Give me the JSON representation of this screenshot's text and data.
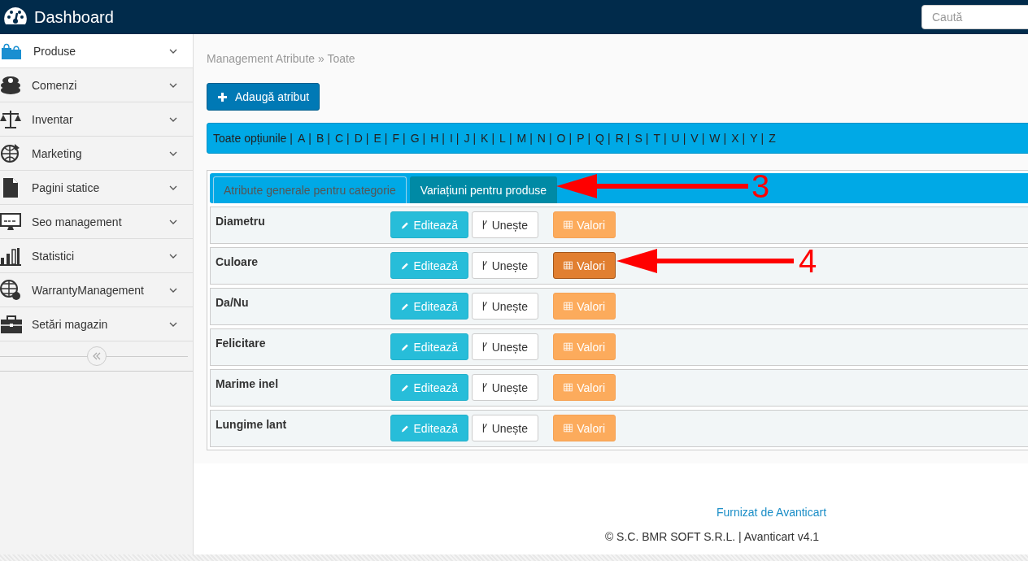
{
  "header": {
    "title": "Dashboard",
    "search": {
      "placeholder": "Caută"
    }
  },
  "sidebar": {
    "items": [
      {
        "label": "Produse",
        "selected": true
      },
      {
        "label": "Comenzi",
        "selected": false
      },
      {
        "label": "Inventar",
        "selected": false
      },
      {
        "label": "Marketing",
        "selected": false
      },
      {
        "label": "Pagini statice",
        "selected": false
      },
      {
        "label": "Seo management",
        "selected": false
      },
      {
        "label": "Statistici",
        "selected": false
      },
      {
        "label": "WarrantyManagement",
        "selected": false
      },
      {
        "label": "Setări magazin",
        "selected": false
      }
    ]
  },
  "breadcrumb": "Management Atribute » Toate",
  "add_button": "Adaugă atribut",
  "letter_separator": "|",
  "letter_filter": [
    "Toate opțiunile",
    "A",
    "B",
    "C",
    "D",
    "E",
    "F",
    "G",
    "H",
    "I",
    "J",
    "K",
    "L",
    "M",
    "N",
    "O",
    "P",
    "Q",
    "R",
    "S",
    "T",
    "U",
    "V",
    "W",
    "X",
    "Y",
    "Z"
  ],
  "tabs": [
    {
      "label": "Atribute generale pentru categorie",
      "selected": false
    },
    {
      "label": "Variațiuni pentru produse",
      "selected": true
    }
  ],
  "rows": [
    {
      "name": "Diametru",
      "edit": "Editează",
      "merge": "Unește",
      "values": "Valori",
      "values_active": false
    },
    {
      "name": "Culoare",
      "edit": "Editează",
      "merge": "Unește",
      "values": "Valori",
      "values_active": true
    },
    {
      "name": "Da/Nu",
      "edit": "Editează",
      "merge": "Unește",
      "values": "Valori",
      "values_active": false
    },
    {
      "name": "Felicitare",
      "edit": "Editează",
      "merge": "Unește",
      "values": "Valori",
      "values_active": false
    },
    {
      "name": "Marime inel",
      "edit": "Editează",
      "merge": "Unește",
      "values": "Valori",
      "values_active": false
    },
    {
      "name": "Lungime lant",
      "edit": "Editează",
      "merge": "Unește",
      "values": "Valori",
      "values_active": false
    }
  ],
  "annotations": [
    {
      "label": "3"
    },
    {
      "label": "4"
    }
  ],
  "footer": {
    "link": "Furnizat de Avanticart",
    "copyright": "© S.C. BMR SOFT S.R.L. | Avanticart v4.1"
  }
}
